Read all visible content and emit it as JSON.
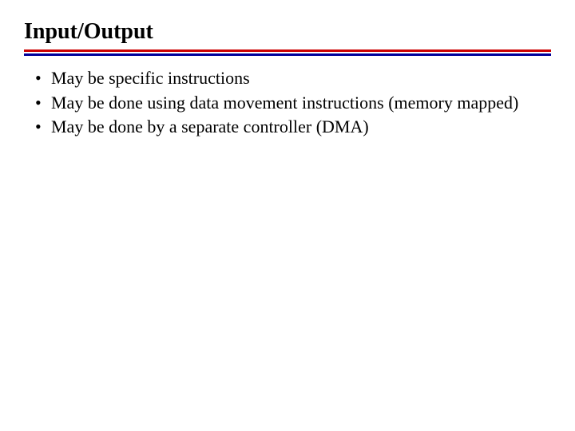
{
  "title": "Input/Output",
  "bullets": [
    "May be specific instructions",
    "May be done using data movement instructions (memory mapped)",
    "May be done by a separate controller (DMA)"
  ]
}
